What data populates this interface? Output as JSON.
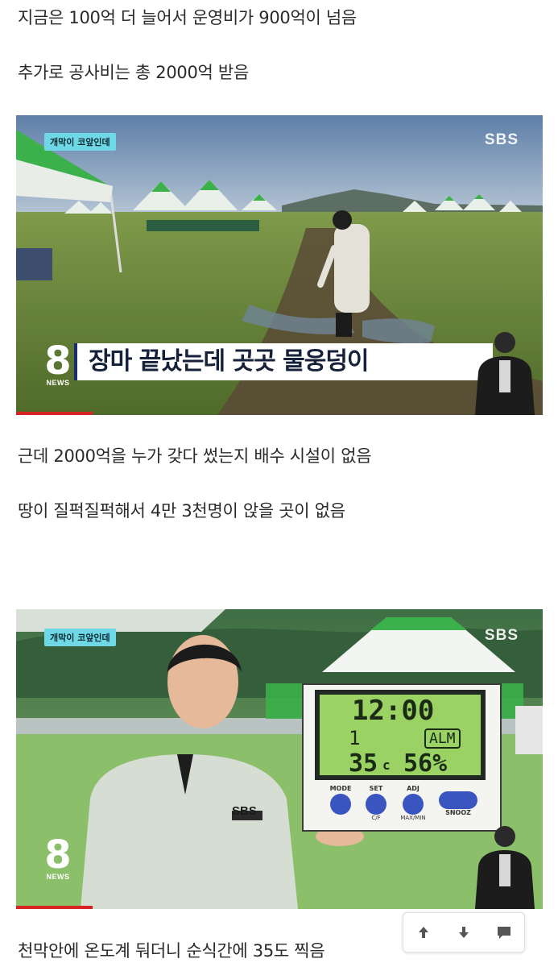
{
  "paragraphs": {
    "p1": "지금은 100억 더 늘어서 운영비가 900억이 넘음",
    "p2": "추가로 공사비는 총 2000억 받음",
    "p3": "근데 2000억을 누가 갖다 썼는지 배수 시설이 없음",
    "p4": "땅이 질퍽질퍽해서 4만 3천명이 앉을 곳이 없음",
    "p5": "천막안에 온도계 둬더니 순식간에 35도 찍음"
  },
  "video1": {
    "badge": "개막이 코앞인데",
    "logo": "SBS",
    "news_number": "8",
    "news_label": "NEWS",
    "caption": "장마 끝났는데 곳곳 물웅덩이"
  },
  "video2": {
    "badge": "개막이 코앞인데",
    "logo": "SBS",
    "news_number": "8",
    "news_label": "NEWS",
    "jacket_logo": "SBS",
    "thermometer": {
      "time": "12:00",
      "day": "1",
      "alarm": "ALM",
      "temperature": "35",
      "temp_unit": "c",
      "humidity": "56%",
      "buttons": [
        "MODE",
        "SET",
        "ADJ",
        "SNOOZ"
      ],
      "sub_labels": [
        "C/F",
        "MAX/MIN"
      ]
    }
  },
  "nav": {
    "icons": [
      "arrow-up-icon",
      "arrow-down-icon",
      "comment-icon"
    ]
  },
  "colors": {
    "badge": "#6fd8e6",
    "caption_border": "#1a2c6e",
    "progress": "#d82323",
    "tent_green": "#3cb04a"
  }
}
